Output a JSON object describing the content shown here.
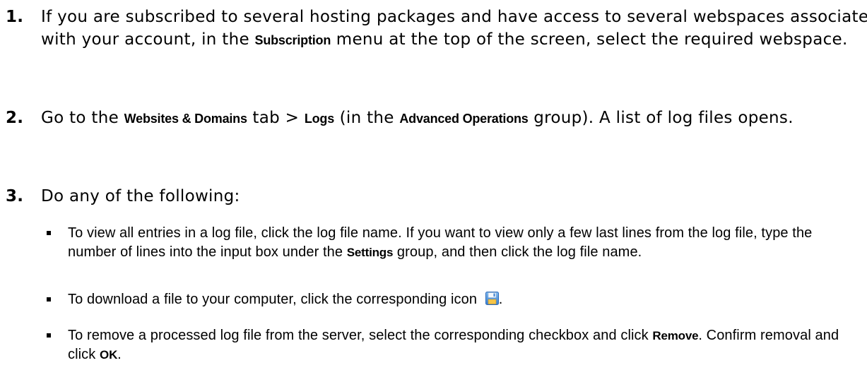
{
  "steps": [
    {
      "number": "1.",
      "t1": "If you are subscribed to several hosting packages and have access to several webspaces associated with your account, in the ",
      "ui1": "Subscription",
      "t2": " menu at the top of the screen, select the required webspace."
    },
    {
      "number": "2.",
      "t1": "Go to the ",
      "ui1": "Websites & Domains",
      "t2": " tab > ",
      "ui2": "Logs",
      "t3": " (in the ",
      "ui3": "Advanced Operations",
      "t4": " group). A list of log files opens."
    },
    {
      "number": "3.",
      "t1": "Do any of the following:"
    }
  ],
  "bullets": [
    {
      "t1": "To view all entries in a log file, click the log file name. If you want to view only a few last lines from the log file, type the number of lines into the input box under the ",
      "ui1": "Settings",
      "t2": " group, and then click the log file name."
    },
    {
      "t1": "To download a file to your computer, click the corresponding icon ",
      "t2": ".",
      "icon": "save-icon"
    },
    {
      "t1": "To remove a processed log file from the server, select the corresponding checkbox and click ",
      "ui1": "Remove",
      "t2": ". Confirm removal and click ",
      "ui2": "OK",
      "t3": "."
    }
  ]
}
